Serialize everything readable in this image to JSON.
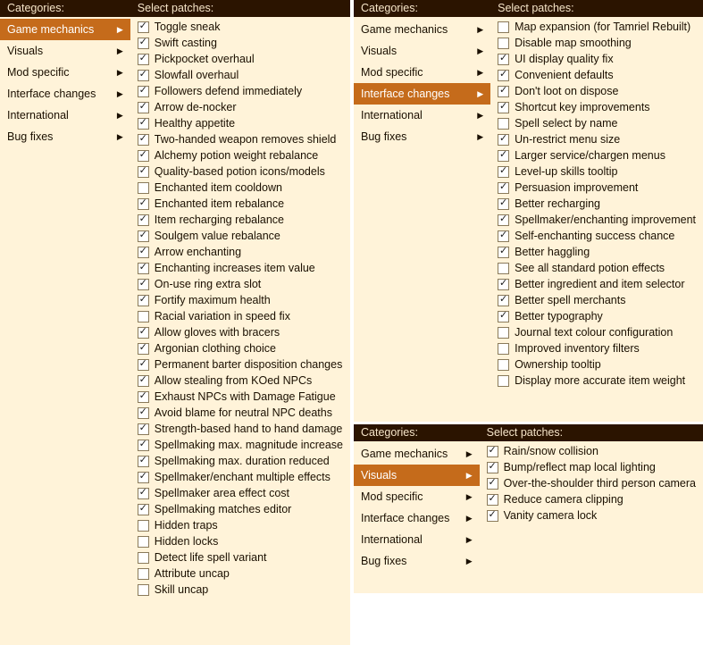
{
  "labels": {
    "categories_header": "Categories:",
    "patches_header": "Select patches:"
  },
  "categories": [
    {
      "id": "gm",
      "label": "Game mechanics"
    },
    {
      "id": "vi",
      "label": "Visuals"
    },
    {
      "id": "ms",
      "label": "Mod specific"
    },
    {
      "id": "ic",
      "label": "Interface changes"
    },
    {
      "id": "in",
      "label": "International"
    },
    {
      "id": "bf",
      "label": "Bug fixes"
    }
  ],
  "panels": {
    "gm": {
      "selected": "gm",
      "patches": [
        {
          "c": true,
          "l": "Toggle sneak"
        },
        {
          "c": true,
          "l": "Swift casting"
        },
        {
          "c": true,
          "l": "Pickpocket overhaul"
        },
        {
          "c": true,
          "l": "Slowfall overhaul"
        },
        {
          "c": true,
          "l": "Followers defend immediately"
        },
        {
          "c": true,
          "l": "Arrow de-nocker"
        },
        {
          "c": true,
          "l": "Healthy appetite"
        },
        {
          "c": true,
          "l": "Two-handed weapon removes shield"
        },
        {
          "c": true,
          "l": "Alchemy potion weight rebalance"
        },
        {
          "c": true,
          "l": "Quality-based potion icons/models"
        },
        {
          "c": false,
          "l": "Enchanted item cooldown"
        },
        {
          "c": true,
          "l": "Enchanted item rebalance"
        },
        {
          "c": true,
          "l": "Item recharging rebalance"
        },
        {
          "c": true,
          "l": "Soulgem value rebalance"
        },
        {
          "c": true,
          "l": "Arrow enchanting"
        },
        {
          "c": true,
          "l": "Enchanting increases item value"
        },
        {
          "c": true,
          "l": "On-use ring extra slot"
        },
        {
          "c": true,
          "l": "Fortify maximum health"
        },
        {
          "c": false,
          "l": "Racial variation in speed fix"
        },
        {
          "c": true,
          "l": "Allow gloves with bracers"
        },
        {
          "c": true,
          "l": "Argonian clothing choice"
        },
        {
          "c": true,
          "l": "Permanent barter disposition changes"
        },
        {
          "c": true,
          "l": "Allow stealing from KOed NPCs"
        },
        {
          "c": true,
          "l": "Exhaust NPCs with Damage Fatigue"
        },
        {
          "c": true,
          "l": "Avoid blame for neutral NPC deaths"
        },
        {
          "c": true,
          "l": "Strength-based hand to hand damage"
        },
        {
          "c": true,
          "l": "Spellmaking max. magnitude increase"
        },
        {
          "c": true,
          "l": "Spellmaking max. duration reduced"
        },
        {
          "c": true,
          "l": "Spellmaker/enchant multiple effects"
        },
        {
          "c": true,
          "l": "Spellmaker area effect cost"
        },
        {
          "c": true,
          "l": "Spellmaking matches editor"
        },
        {
          "c": false,
          "l": "Hidden traps"
        },
        {
          "c": false,
          "l": "Hidden locks"
        },
        {
          "c": false,
          "l": "Detect life spell variant"
        },
        {
          "c": false,
          "l": "Attribute uncap"
        },
        {
          "c": false,
          "l": "Skill uncap"
        }
      ]
    },
    "ic": {
      "selected": "ic",
      "patches": [
        {
          "c": false,
          "l": "Map expansion (for Tamriel Rebuilt)"
        },
        {
          "c": false,
          "l": "Disable map smoothing"
        },
        {
          "c": true,
          "l": "UI display quality fix"
        },
        {
          "c": true,
          "l": "Convenient defaults"
        },
        {
          "c": true,
          "l": "Don't loot on dispose"
        },
        {
          "c": true,
          "l": "Shortcut key improvements"
        },
        {
          "c": false,
          "l": "Spell select by name"
        },
        {
          "c": true,
          "l": "Un-restrict menu size"
        },
        {
          "c": true,
          "l": "Larger service/chargen menus"
        },
        {
          "c": true,
          "l": "Level-up skills tooltip"
        },
        {
          "c": true,
          "l": "Persuasion improvement"
        },
        {
          "c": true,
          "l": "Better recharging"
        },
        {
          "c": true,
          "l": "Spellmaker/enchanting improvement"
        },
        {
          "c": true,
          "l": "Self-enchanting success chance"
        },
        {
          "c": true,
          "l": "Better haggling"
        },
        {
          "c": false,
          "l": "See all standard potion effects"
        },
        {
          "c": true,
          "l": "Better ingredient and item selector"
        },
        {
          "c": true,
          "l": "Better spell merchants"
        },
        {
          "c": true,
          "l": "Better typography"
        },
        {
          "c": false,
          "l": "Journal text colour configuration"
        },
        {
          "c": false,
          "l": "Improved inventory filters"
        },
        {
          "c": false,
          "l": "Ownership tooltip"
        },
        {
          "c": false,
          "l": "Display more accurate item weight"
        }
      ]
    },
    "vi": {
      "selected": "vi",
      "patches": [
        {
          "c": true,
          "l": "Rain/snow collision"
        },
        {
          "c": true,
          "l": "Bump/reflect map local lighting"
        },
        {
          "c": true,
          "l": "Over-the-shoulder third person camera"
        },
        {
          "c": true,
          "l": "Reduce camera clipping"
        },
        {
          "c": true,
          "l": "Vanity camera lock"
        }
      ]
    }
  }
}
